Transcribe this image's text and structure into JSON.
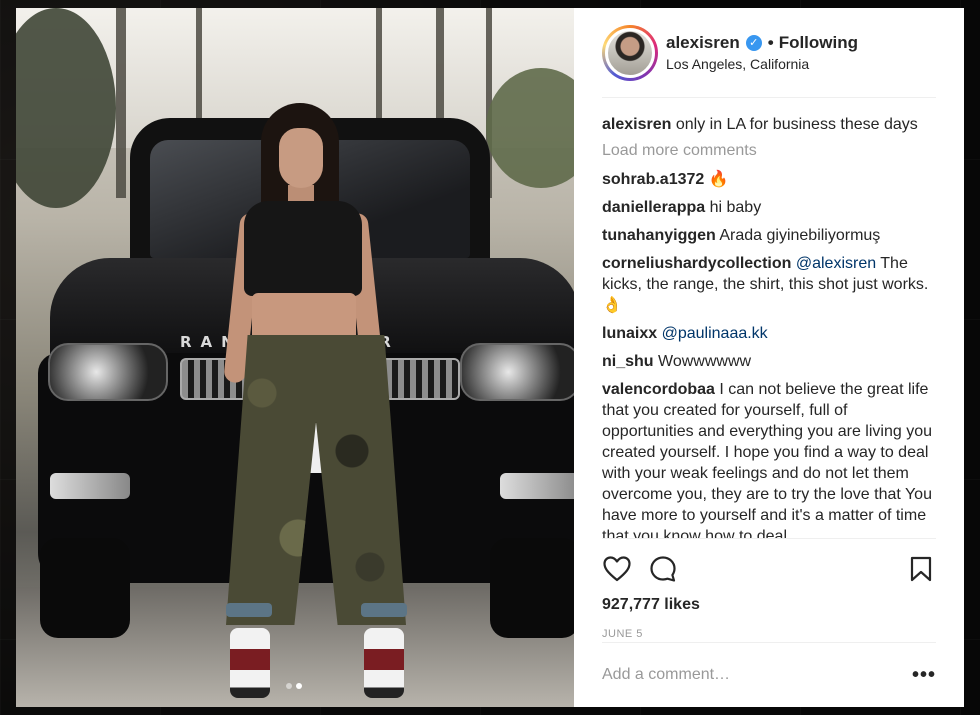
{
  "post": {
    "username": "alexisren",
    "verified_icon": "verified-badge-icon",
    "bullet": "•",
    "follow_status": "Following",
    "location": "Los Angeles, California",
    "car_brand_text": "RANGE ROVER",
    "carousel": {
      "total": 2,
      "active": 2
    }
  },
  "caption": {
    "user": "alexisren",
    "text": "only in LA for business these days"
  },
  "load_more": "Load more comments",
  "comments": [
    {
      "user": "sohrab.a1372",
      "text": "🔥"
    },
    {
      "user": "daniellerappa",
      "text": "hi baby"
    },
    {
      "user": "tunahanyiggen",
      "text": "Arada giyinebiliyormuş"
    },
    {
      "user": "corneliushardycollection",
      "mention": "@alexisren",
      "text": "The kicks, the range, the shirt, this shot just works. 👌"
    },
    {
      "user": "lunaixx",
      "mention": "@paulinaaa.kk",
      "text": ""
    },
    {
      "user": "ni_shu",
      "text": "Wowwwwww"
    },
    {
      "user": "valencordobaa",
      "text": "I can not believe the great life that you created for yourself, full of opportunities and everything you are living you created yourself. I hope you find a way to deal with your weak feelings and do not let them overcome you, they are to try the love that You have more to yourself and it's a matter of time that you know how to deal"
    }
  ],
  "actions": {
    "like_icon": "heart-icon",
    "comment_icon": "comment-bubble-icon",
    "save_icon": "bookmark-icon"
  },
  "likes": "927,777 likes",
  "date": "JUNE 5",
  "add_comment": {
    "placeholder": "Add a comment…",
    "more": "•••"
  },
  "colors": {
    "accent": "#3897f0",
    "mention": "#003569",
    "muted": "#999999",
    "text": "#262626"
  }
}
